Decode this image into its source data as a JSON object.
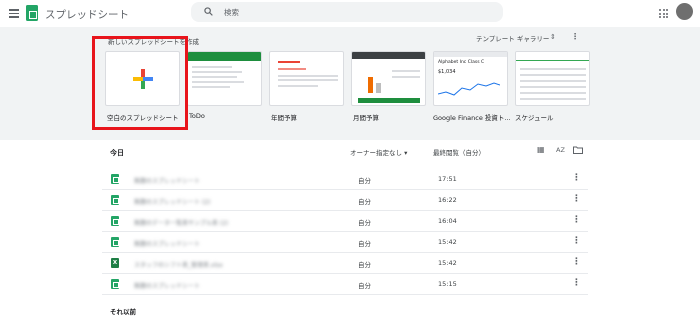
{
  "header": {
    "app_title": "スプレッドシート",
    "search_placeholder": "検索"
  },
  "templates": {
    "heading": "新しいスプレッドシートを作成",
    "gallery_label": "テンプレート ギャラリー",
    "items": [
      {
        "label": "空白のスプレッドシート",
        "icon": "plus-icon"
      },
      {
        "label": "ToDo"
      },
      {
        "label": "年間予算"
      },
      {
        "label": "月間予算"
      },
      {
        "label": "Google Finance 投資ト..."
      },
      {
        "label": "スケジュール"
      }
    ],
    "preview_text": {
      "finance_title": "Alphabet Inc Class C",
      "finance_price": "$1,034"
    }
  },
  "list": {
    "section_today": "今日",
    "owner_filter": "オーナー指定なし",
    "last_opened_label": "最終閲覧（自分）",
    "sort_label": "AZ",
    "rows": [
      {
        "name": "無題のスプレッドシート",
        "owner": "自分",
        "time": "17:51",
        "type": "sheet"
      },
      {
        "name": "無題のスプレッドシート (2)",
        "owner": "自分",
        "time": "16:22",
        "type": "sheet"
      },
      {
        "name": "無題のデータ一覧表サンプル表 (2)",
        "owner": "自分",
        "time": "16:04",
        "type": "sheet"
      },
      {
        "name": "無題のスプレッドシート",
        "owner": "自分",
        "time": "15:42",
        "type": "sheet"
      },
      {
        "name": "スタッフのシフト表_管理表.xlsx",
        "owner": "自分",
        "time": "15:42",
        "type": "excel"
      },
      {
        "name": "無題のスプレッドシート",
        "owner": "自分",
        "time": "15:15",
        "type": "sheet"
      }
    ],
    "section_earlier": "それ以前"
  },
  "colors": {
    "highlight": "#e8141b",
    "sheets_green": "#23a566",
    "template_bg": "#f1f3f4"
  }
}
